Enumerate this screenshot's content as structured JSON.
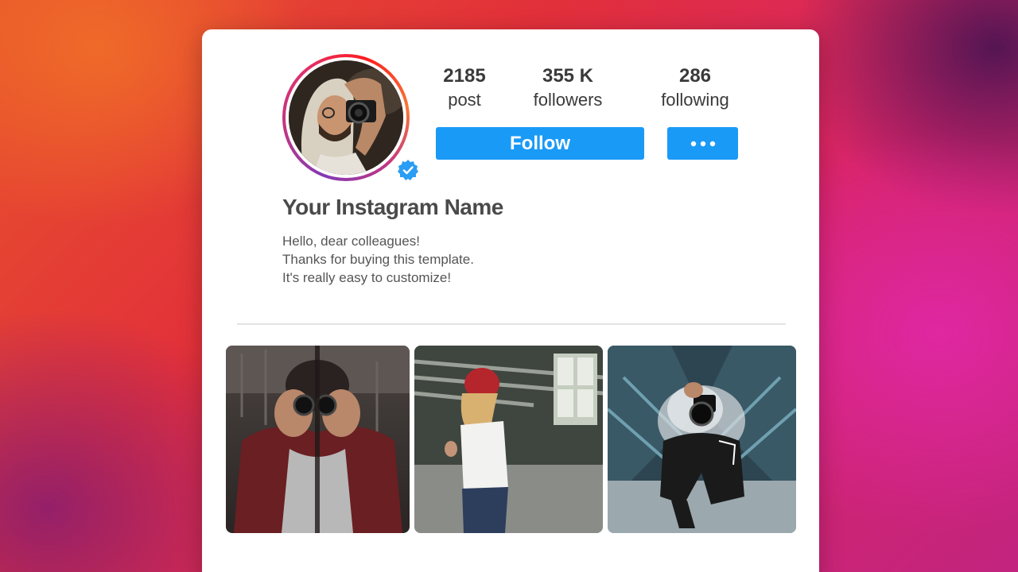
{
  "profile": {
    "name": "Your Instagram Name",
    "bio": [
      "Hello, dear colleagues!",
      "Thanks for buying this template.",
      "It's really easy to customize!"
    ],
    "verified": true
  },
  "stats": {
    "posts": {
      "value": "2185",
      "label": "post"
    },
    "followers": {
      "value": "355 K",
      "label": "followers"
    },
    "following": {
      "value": "286",
      "label": "following"
    }
  },
  "actions": {
    "follow_label": "Follow",
    "more_icon": "more-dots-icon"
  },
  "grid": {
    "photos": [
      {
        "icon": "photo-man-binoculars"
      },
      {
        "icon": "photo-woman-red-beanie"
      },
      {
        "icon": "photo-photographer-smoke"
      }
    ]
  },
  "colors": {
    "accent": "#1a9af7",
    "text": "#3a3a3a",
    "verified": "#2a9df4"
  }
}
